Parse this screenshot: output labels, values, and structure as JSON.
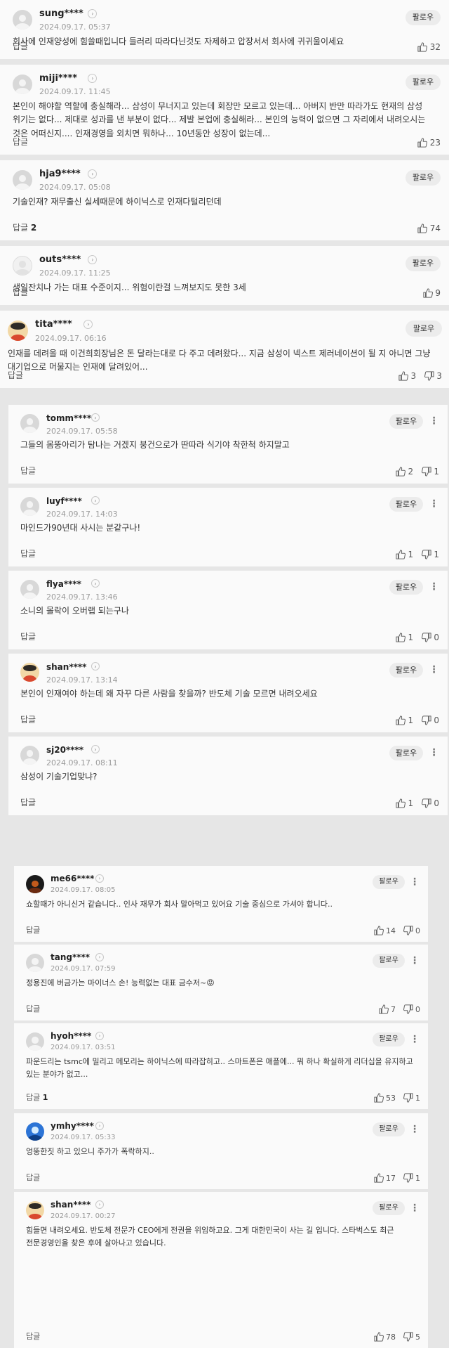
{
  "labels": {
    "follow": "팔로우",
    "reply": "답글",
    "more": "⋮"
  },
  "comments": [
    {
      "user": "sung****",
      "date": "2024.09.17. 05:37",
      "text": "회사에 인재양성에 힘쓸때입니다 들러리 따라다닌것도 자제하고 압장서서 회사에 귀귀울이세요",
      "reply_count": "",
      "likes": "32",
      "dislikes": ""
    },
    {
      "user": "miji****",
      "date": "2024.09.17. 11:45",
      "text": "본인이 해야할 역할에 충실해라... 삼성이 무너지고 있는데 회장만 모르고 있는데... 아버지 반만 따라가도 현재의 삼성 위기는 없다... 제대로 성과를 낸 부분이 없다... 제발 본업에 충실해라... 본인의 능력이 없으면 그 자리에서 내려오시는 것은 어떠신지.... 인재경영을 외치면 뭐하나... 10년동안 성장이 없는데...",
      "reply_count": "",
      "likes": "23",
      "dislikes": ""
    },
    {
      "user": "hja9****",
      "date": "2024.09.17. 05:08",
      "text": "기술인재? 재무출신 실세때문에 하이닉스로 인재다털리던데",
      "reply_count": "2",
      "likes": "74",
      "dislikes": ""
    },
    {
      "user": "outs****",
      "date": "2024.09.17. 11:25",
      "text": "생일잔치나 가는 대표 수준이지... 위험이란걸 느껴보지도 못한 3세",
      "reply_count": "",
      "likes": "9",
      "dislikes": ""
    },
    {
      "user": "tita****",
      "date": "2024.09.17. 06:16",
      "text": "인재를 데려올 때 이건희회장님은 돈 달라는대로 다 주고 데려왔다... 지금 삼성이 넥스트 제러네이션이 될 지 아니면 그냥 대기업으로 머물지는 인재에 달려있어...",
      "reply_count": "",
      "likes": "3",
      "dislikes": "3"
    },
    {
      "user": "tomm****",
      "date": "2024.09.17. 05:58",
      "text": "그들의 몸뚱아리가 탐나는 거겠지 붕건으로가 딴따라 식기야 착한척 하지말고",
      "reply_count": "",
      "likes": "2",
      "dislikes": "1"
    },
    {
      "user": "luyf****",
      "date": "2024.09.17. 14:03",
      "text": "마인드가90년대 사시는 분같구나!",
      "reply_count": "",
      "likes": "1",
      "dislikes": "1"
    },
    {
      "user": "flya****",
      "date": "2024.09.17. 13:46",
      "text": "소니의 몰락이 오버랩 되는구나",
      "reply_count": "",
      "likes": "1",
      "dislikes": "0"
    },
    {
      "user": "shan****",
      "date": "2024.09.17. 13:14",
      "text": "본인이 인재여야 하는데 왜 자꾸 다른 사람을 찾을까? 반도체 기술 모르면 내려오세요",
      "reply_count": "",
      "likes": "1",
      "dislikes": "0"
    },
    {
      "user": "sj20****",
      "date": "2024.09.17. 08:11",
      "text": "삼성이 기술기업맞냐?",
      "reply_count": "",
      "likes": "1",
      "dislikes": "0"
    },
    {
      "user": "me66****",
      "date": "2024.09.17. 08:05",
      "text": "쇼할때가 아니신거 같습니다.. 인사 재무가 회사 말아먹고 있어요 기술 중심으로 가셔야 합니다..",
      "reply_count": "",
      "likes": "14",
      "dislikes": "0"
    },
    {
      "user": "tang****",
      "date": "2024.09.17. 07:59",
      "text": "정용진에 버금가는 마이너스 손! 능력없는 대표 금수저~😡",
      "reply_count": "",
      "likes": "7",
      "dislikes": "0"
    },
    {
      "user": "hyoh****",
      "date": "2024.09.17. 03:51",
      "text": "파운드리는 tsmc에 밀리고 메모리는 하이닉스에 따라잡히고.. 스마트폰은 애플에... 뭐 하나 확실하게 리더십을 유지하고 있는 분야가 없고...",
      "reply_count": "1",
      "likes": "53",
      "dislikes": "1"
    },
    {
      "user": "ymhy****",
      "date": "2024.09.17. 05:33",
      "text": "엉뚱한짓 하고 있으니 주가가 폭락하지..",
      "reply_count": "",
      "likes": "17",
      "dislikes": "1"
    },
    {
      "user": "shan****",
      "date": "2024.09.17. 00:27",
      "text": "힘들면 내려오세요. 반도체 전문가 CEO에게 전권을 위임하고요. 그게 대한민국이 사는 길 입니다. 스타벅스도 최근 전문경영인을 찾은 후에 살아나고 있습니다.",
      "reply_count": "",
      "likes": "78",
      "dislikes": "5"
    }
  ]
}
